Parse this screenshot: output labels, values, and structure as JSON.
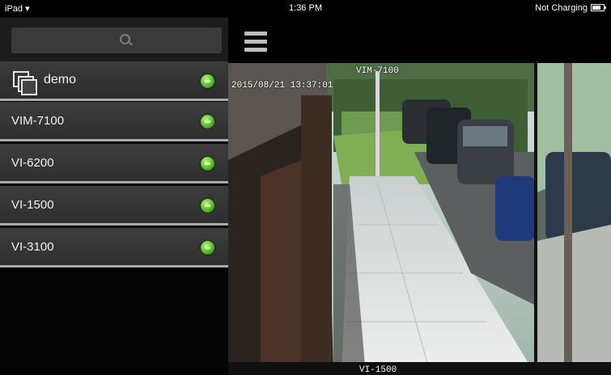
{
  "status_bar": {
    "device": "iPad",
    "time": "1:36 PM",
    "battery_status": "Not Charging"
  },
  "search": {
    "placeholder": ""
  },
  "sidebar": {
    "items": [
      {
        "label": "demo",
        "type": "group",
        "status": "online",
        "status_color": "#4cb51f"
      },
      {
        "label": "VIM-7100",
        "type": "camera",
        "status": "online",
        "status_color": "#4cb51f"
      },
      {
        "label": "VI-6200",
        "type": "camera",
        "status": "online",
        "status_color": "#4cb51f"
      },
      {
        "label": "VI-1500",
        "type": "camera",
        "status": "online",
        "status_color": "#4cb51f"
      },
      {
        "label": "VI-3100",
        "type": "camera",
        "status": "online",
        "status_color": "#4cb51f"
      }
    ]
  },
  "video": {
    "camera_name": "VIM-7100",
    "timestamp": "2015/08/21 13:37:01",
    "next_camera_name": "VI-1500"
  },
  "icons": {
    "menu": "menu-icon",
    "search": "search-icon",
    "group": "multi-window-icon",
    "status": "online-status-icon"
  },
  "colors": {
    "status_online": "#4cb51f",
    "sidebar_item_bg": "#363636",
    "divider": "#aaaaaa"
  }
}
